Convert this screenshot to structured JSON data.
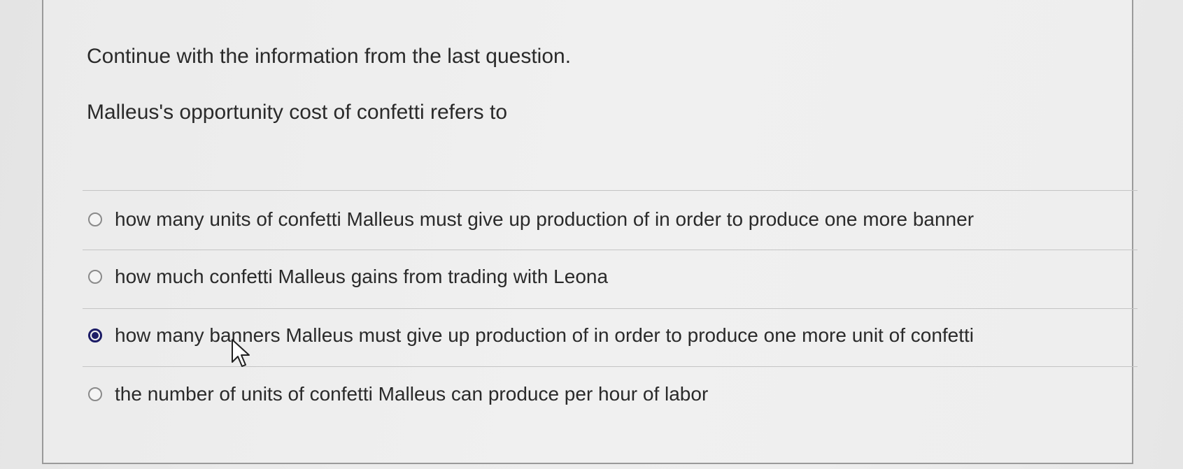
{
  "question": {
    "intro": "Continue with the information from the last question.",
    "prompt": "Malleus's opportunity cost of confetti refers to"
  },
  "options": [
    {
      "label": "how many units of confetti Malleus must give up production of in order to produce one more banner",
      "selected": false
    },
    {
      "label": "how much confetti Malleus gains from trading with Leona",
      "selected": false
    },
    {
      "label": "how many banners Malleus must give up production of in order to produce one more unit of confetti",
      "selected": true
    },
    {
      "label": "the number of units of confetti Malleus can produce per hour of labor",
      "selected": false
    }
  ],
  "colors": {
    "selected_radio": "#1c1c66",
    "text": "#2a2a2a",
    "divider": "#c4c4c4"
  },
  "icons": {
    "cursor": "mouse-pointer-icon"
  }
}
